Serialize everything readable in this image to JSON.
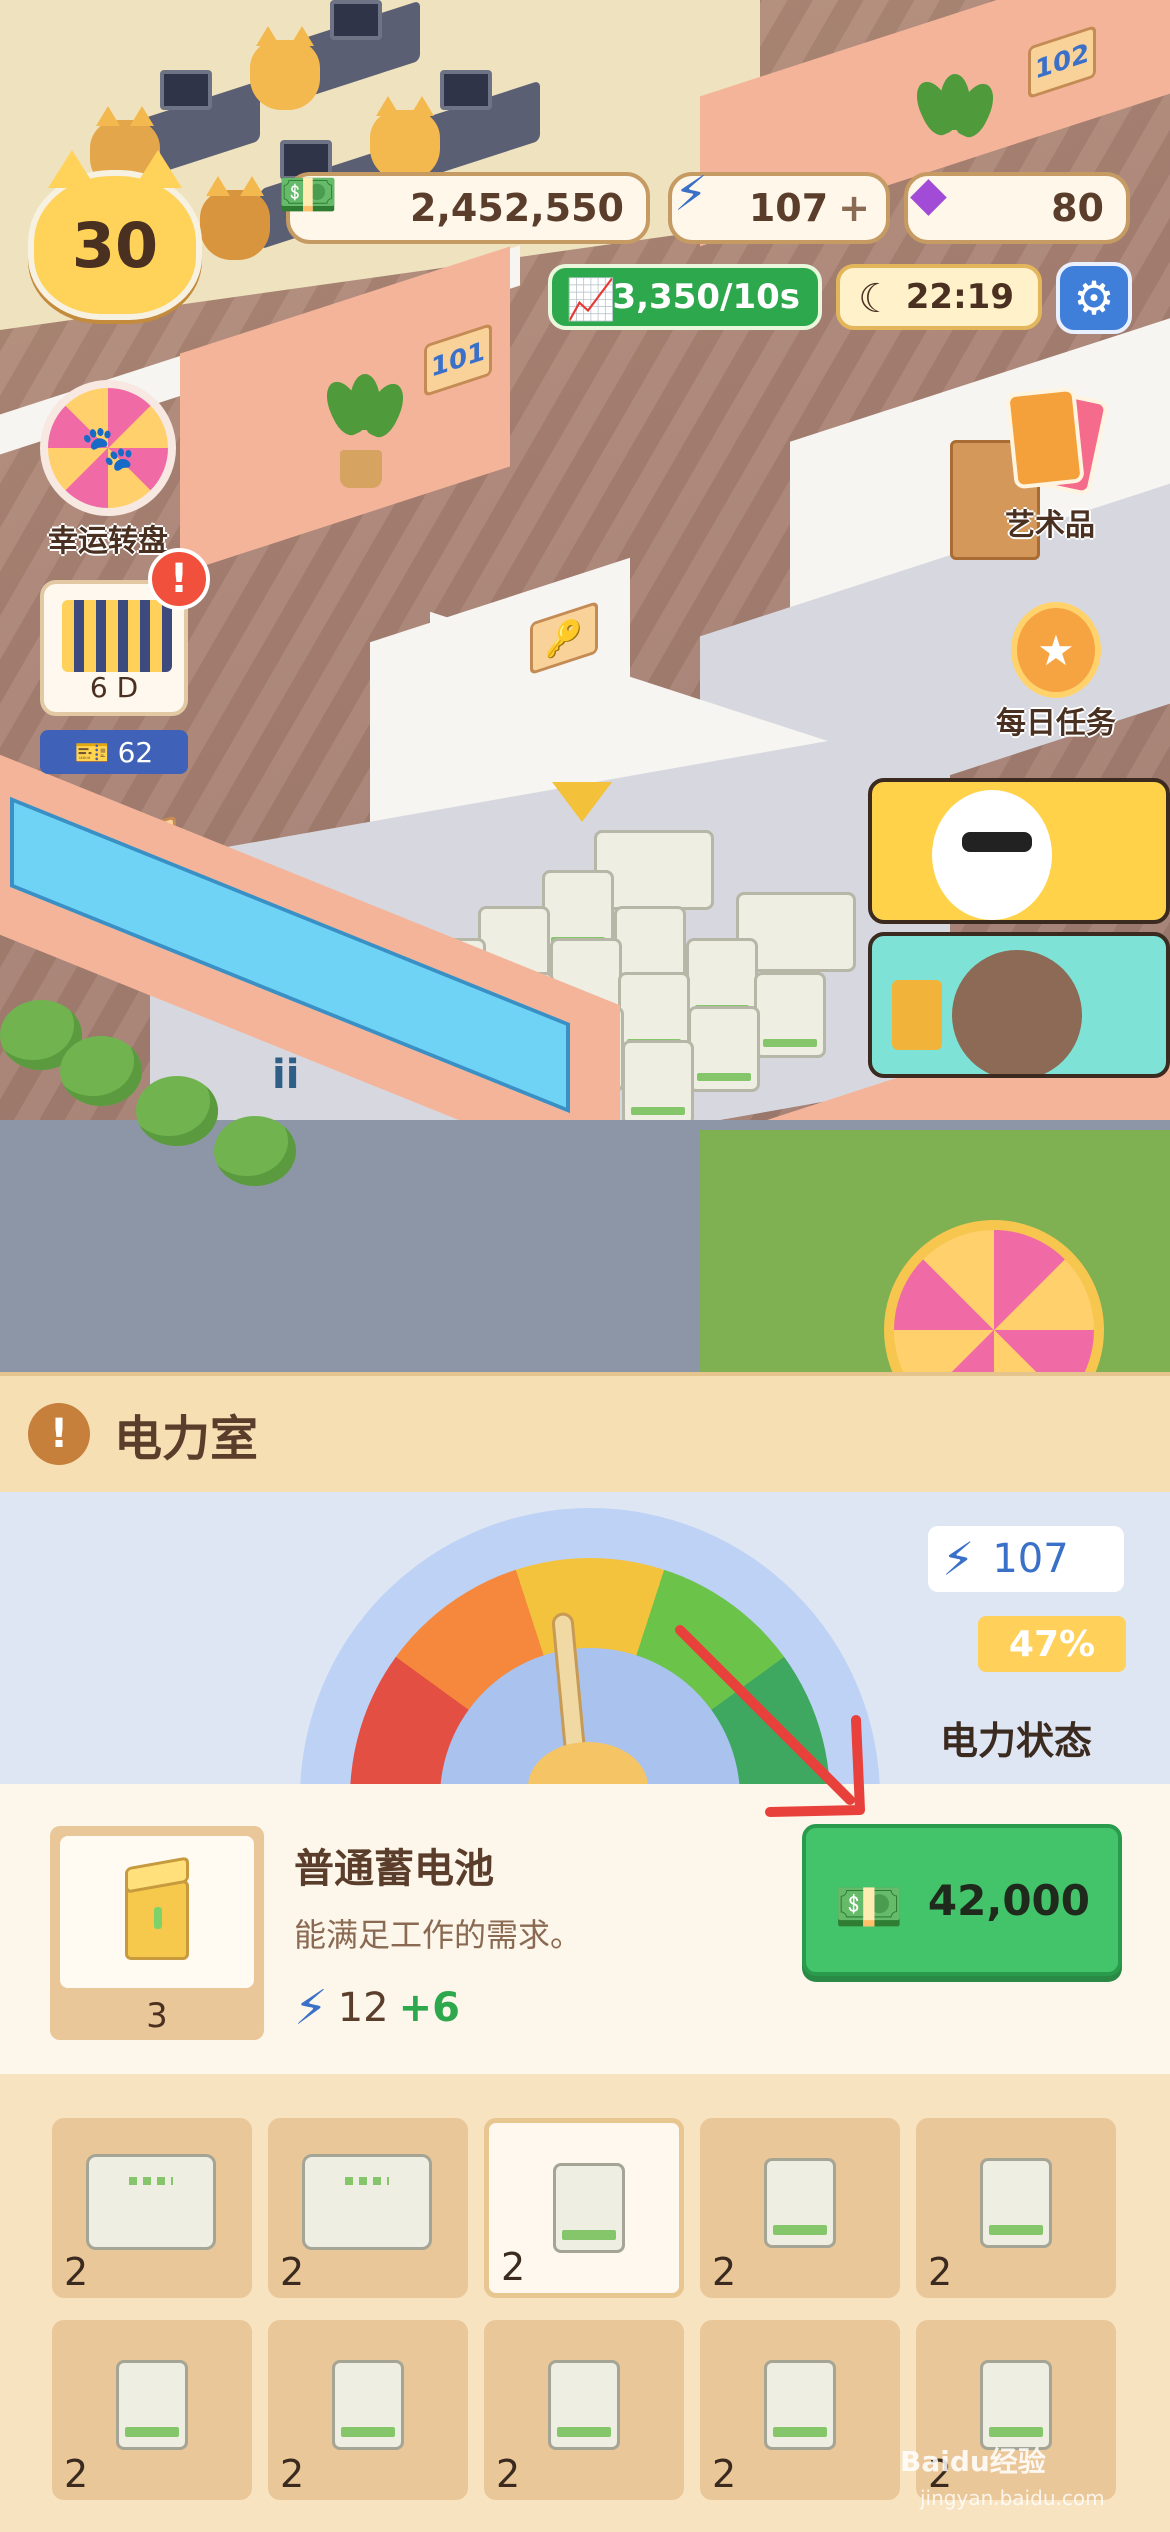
{
  "hud": {
    "cash": "2,452,550",
    "energy": "107",
    "energy_plus": "+",
    "gems": "80",
    "level": "30",
    "income_rate": "3,350/10s",
    "clock": "22:19"
  },
  "side_buttons": {
    "lucky_wheel_label": "幸运转盘",
    "building_days": "6 D",
    "building_alert": "!",
    "tickets": "62",
    "artwork_label": "艺术品",
    "daily_tasks_label": "每日任务"
  },
  "scene": {
    "room_101": "101",
    "room_102": "102",
    "pillar_mark": "ii"
  },
  "panel": {
    "title": "电力室",
    "warning_glyph": "!",
    "power_value": "107",
    "power_percent": "47%",
    "power_status_label": "电力状态",
    "power_level_fraction": 0.47
  },
  "item": {
    "name": "普通蓄电池",
    "description": "能满足工作的需求。",
    "owned_count": "3",
    "power_base": "12",
    "power_bonus": "+6",
    "price": "42,000"
  },
  "grid": {
    "cells": [
      {
        "kind": "generator",
        "count": "2",
        "selected": false
      },
      {
        "kind": "generator",
        "count": "2",
        "selected": false
      },
      {
        "kind": "battery",
        "count": "2",
        "selected": true
      },
      {
        "kind": "battery",
        "count": "2",
        "selected": false
      },
      {
        "kind": "battery",
        "count": "2",
        "selected": false
      },
      {
        "kind": "battery",
        "count": "2",
        "selected": false
      },
      {
        "kind": "battery",
        "count": "2",
        "selected": false
      },
      {
        "kind": "battery",
        "count": "2",
        "selected": false
      },
      {
        "kind": "battery",
        "count": "2",
        "selected": false
      },
      {
        "kind": "battery",
        "count": "2",
        "selected": false
      }
    ]
  },
  "watermark": {
    "brand": "Baidu经验",
    "url": "jingyan.baidu.com"
  },
  "colors": {
    "accent_green": "#43c46a",
    "energy_blue": "#3a70c8",
    "gem_purple": "#a24bd6",
    "warning_orange": "#c77f3c",
    "arrow_red": "#e8403a"
  }
}
